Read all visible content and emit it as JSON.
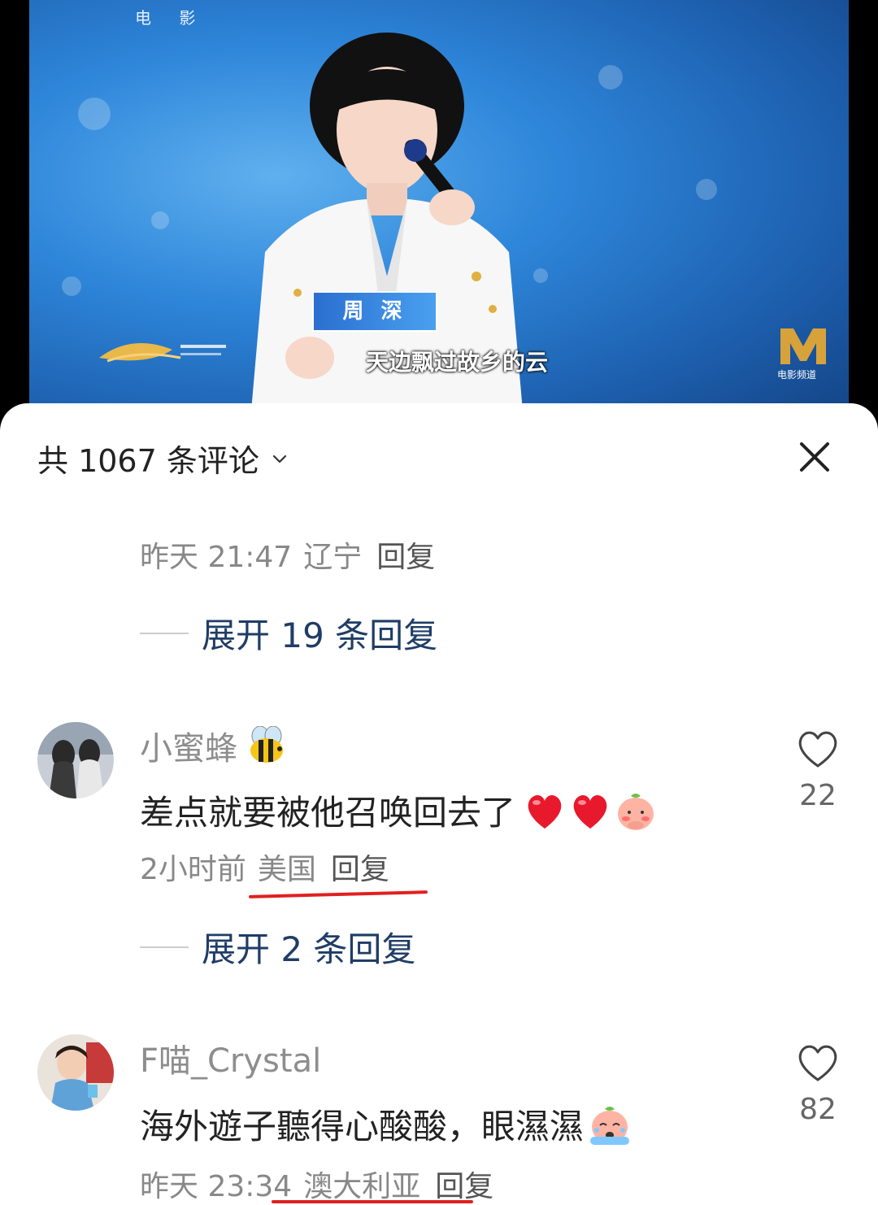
{
  "video": {
    "channel_label": "电 影",
    "lower_third_name": "周 深",
    "subtitle": "天边飘过故乡的云",
    "watermark_label": "电影频道",
    "logo_letter": "M"
  },
  "sheet": {
    "header_title": "共 1067 条评论"
  },
  "thread_prev": {
    "meta_time": "昨天 21:47",
    "meta_location": "辽宁",
    "meta_reply": "回复",
    "expand_label": "展开 19 条回复"
  },
  "comments": [
    {
      "username": "小蜜蜂",
      "text": "差点就要被他召唤回去了",
      "meta_time": "2小时前",
      "meta_location": "美国",
      "meta_reply": "回复",
      "likes": "22",
      "expand_label": "展开 2 条回复"
    },
    {
      "username": "F喵_Crystal",
      "text": "海外遊子聽得心酸酸，眼濕濕",
      "meta_time": "昨天 23:34",
      "meta_location": "澳大利亚",
      "meta_reply": "回复",
      "likes": "82"
    }
  ],
  "icons": {
    "chevron": "chevron-down-icon",
    "close": "close-icon",
    "like": "heart-outline-icon",
    "bee": "bee-emoji",
    "heart": "red-heart-emoji",
    "peach": "peach-emoji"
  },
  "colors": {
    "expand_text": "#1f3d66",
    "highlight_line": "#e02020",
    "video_bg": "#2e86da"
  }
}
